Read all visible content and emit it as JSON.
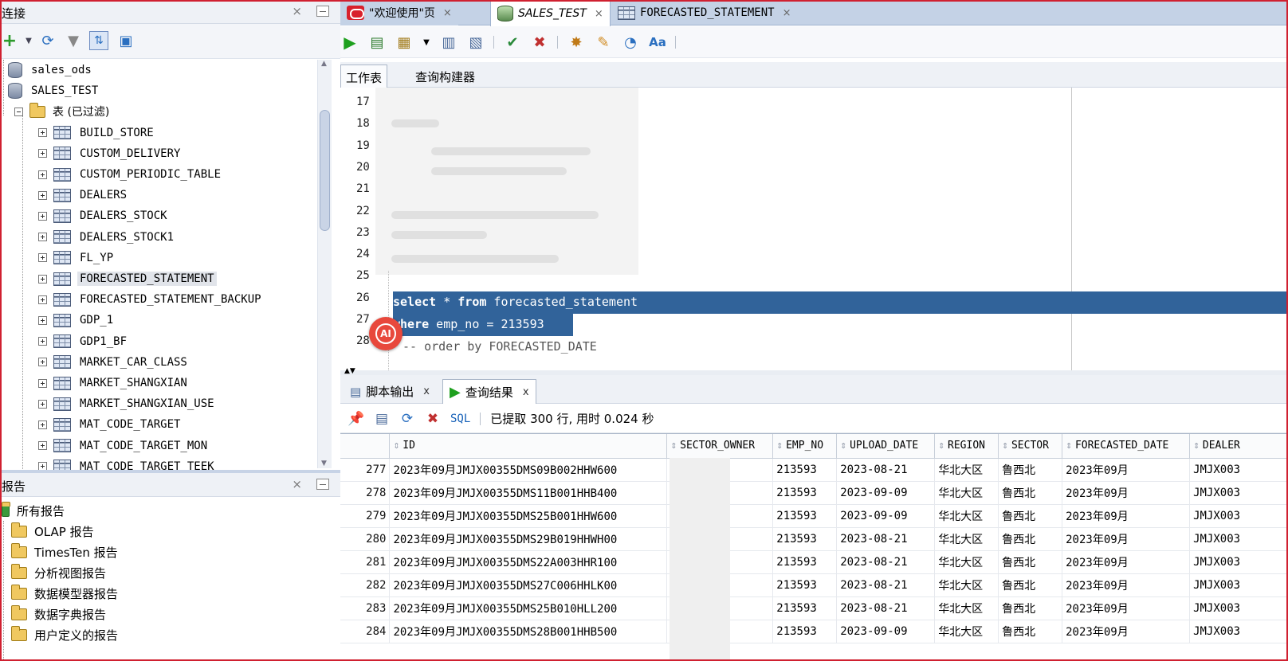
{
  "connections": {
    "panel_title": "连接",
    "close_label": "×",
    "tree": [
      {
        "label": "sales_ods",
        "kind": "db"
      },
      {
        "label": "SALES_TEST",
        "kind": "db"
      },
      {
        "label": "表 (已过滤)",
        "kind": "folder"
      }
    ],
    "tables": [
      "BUILD_STORE",
      "CUSTOM_DELIVERY",
      "CUSTOM_PERIODIC_TABLE",
      "DEALERS",
      "DEALERS_STOCK",
      "DEALERS_STOCK1",
      "FL_YP",
      "FORECASTED_STATEMENT",
      "FORECASTED_STATEMENT_BACKUP",
      "GDP_1",
      "GDP1_BF",
      "MARKET_CAR_CLASS",
      "MARKET_SHANGXIAN",
      "MARKET_SHANGXIAN_USE",
      "MAT_CODE_TARGET",
      "MAT_CODE_TARGET_MON",
      "MAT_CODE_TARGET_TEEK"
    ],
    "selected_table": "FORECASTED_STATEMENT"
  },
  "reports": {
    "panel_title": "报告",
    "close_label": "×",
    "items": [
      "所有报告",
      "OLAP 报告",
      "TimesTen 报告",
      "分析视图报告",
      "数据模型器报告",
      "数据字典报告",
      "用户定义的报告"
    ]
  },
  "editor_tabs": [
    {
      "label": "\"欢迎使用\"页",
      "icon": "oracle-icon"
    },
    {
      "label": "SALES_TEST",
      "icon": "sql-connection-icon",
      "active": true
    },
    {
      "label": "FORECASTED_STATEMENT",
      "icon": "table-icon"
    }
  ],
  "tab_close": "×",
  "worksheet_tabs": [
    "工作表",
    "查询构建器"
  ],
  "editor": {
    "line_numbers": [
      "17",
      "18",
      "19",
      "20",
      "21",
      "22",
      "23",
      "24",
      "25",
      "26",
      "27",
      "28"
    ],
    "line26_kw1": "select",
    "line26_mid": " * ",
    "line26_kw2": "from",
    "line26_rest": " forecasted_statement",
    "line27_kw": "where",
    "line27_rest": " emp_no = 213593",
    "line28": "-- order by FORECASTED_DATE",
    "ai_badge": "AI"
  },
  "output_tabs": [
    {
      "label": "脚本输出",
      "icon": "script-output-icon"
    },
    {
      "label": "查询结果",
      "icon": "run-icon",
      "active": true
    }
  ],
  "output_close": "x",
  "result_toolbar": {
    "sql_link": "SQL",
    "status": "已提取 300 行, 用时 0.024 秒"
  },
  "grid": {
    "columns": [
      "ID",
      "SECTOR_OWNER",
      "EMP_NO",
      "UPLOAD_DATE",
      "REGION",
      "SECTOR",
      "FORECASTED_DATE",
      "DEALER"
    ],
    "rows": [
      {
        "rn": "277",
        "id": "2023年09月JMJX00355DMS09B002HHW600",
        "owner": "",
        "emp": "213593",
        "upload": "2023-08-21",
        "region": "华北大区",
        "sector": "鲁西北",
        "fdate": "2023年09月",
        "dealer": "JMJX003"
      },
      {
        "rn": "278",
        "id": "2023年09月JMJX00355DMS11B001HHB400",
        "owner": "",
        "emp": "213593",
        "upload": "2023-09-09",
        "region": "华北大区",
        "sector": "鲁西北",
        "fdate": "2023年09月",
        "dealer": "JMJX003"
      },
      {
        "rn": "279",
        "id": "2023年09月JMJX00355DMS25B001HHW600",
        "owner": "",
        "emp": "213593",
        "upload": "2023-09-09",
        "region": "华北大区",
        "sector": "鲁西北",
        "fdate": "2023年09月",
        "dealer": "JMJX003"
      },
      {
        "rn": "280",
        "id": "2023年09月JMJX00355DMS29B019HHWH00",
        "owner": "",
        "emp": "213593",
        "upload": "2023-08-21",
        "region": "华北大区",
        "sector": "鲁西北",
        "fdate": "2023年09月",
        "dealer": "JMJX003"
      },
      {
        "rn": "281",
        "id": "2023年09月JMJX00355DMS22A003HHR100",
        "owner": "",
        "emp": "213593",
        "upload": "2023-08-21",
        "region": "华北大区",
        "sector": "鲁西北",
        "fdate": "2023年09月",
        "dealer": "JMJX003"
      },
      {
        "rn": "282",
        "id": "2023年09月JMJX00355DMS27C006HHLK00",
        "owner": "",
        "emp": "213593",
        "upload": "2023-08-21",
        "region": "华北大区",
        "sector": "鲁西北",
        "fdate": "2023年09月",
        "dealer": "JMJX003"
      },
      {
        "rn": "283",
        "id": "2023年09月JMJX00355DMS25B010HLL200",
        "owner": "",
        "emp": "213593",
        "upload": "2023-08-21",
        "region": "华北大区",
        "sector": "鲁西北",
        "fdate": "2023年09月",
        "dealer": "JMJX003"
      },
      {
        "rn": "284",
        "id": "2023年09月JMJX00355DMS28B001HHB500",
        "owner": "",
        "emp": "213593",
        "upload": "2023-09-09",
        "region": "华北大区",
        "sector": "鲁西北",
        "fdate": "2023年09月",
        "dealer": "JMJX003"
      }
    ]
  }
}
